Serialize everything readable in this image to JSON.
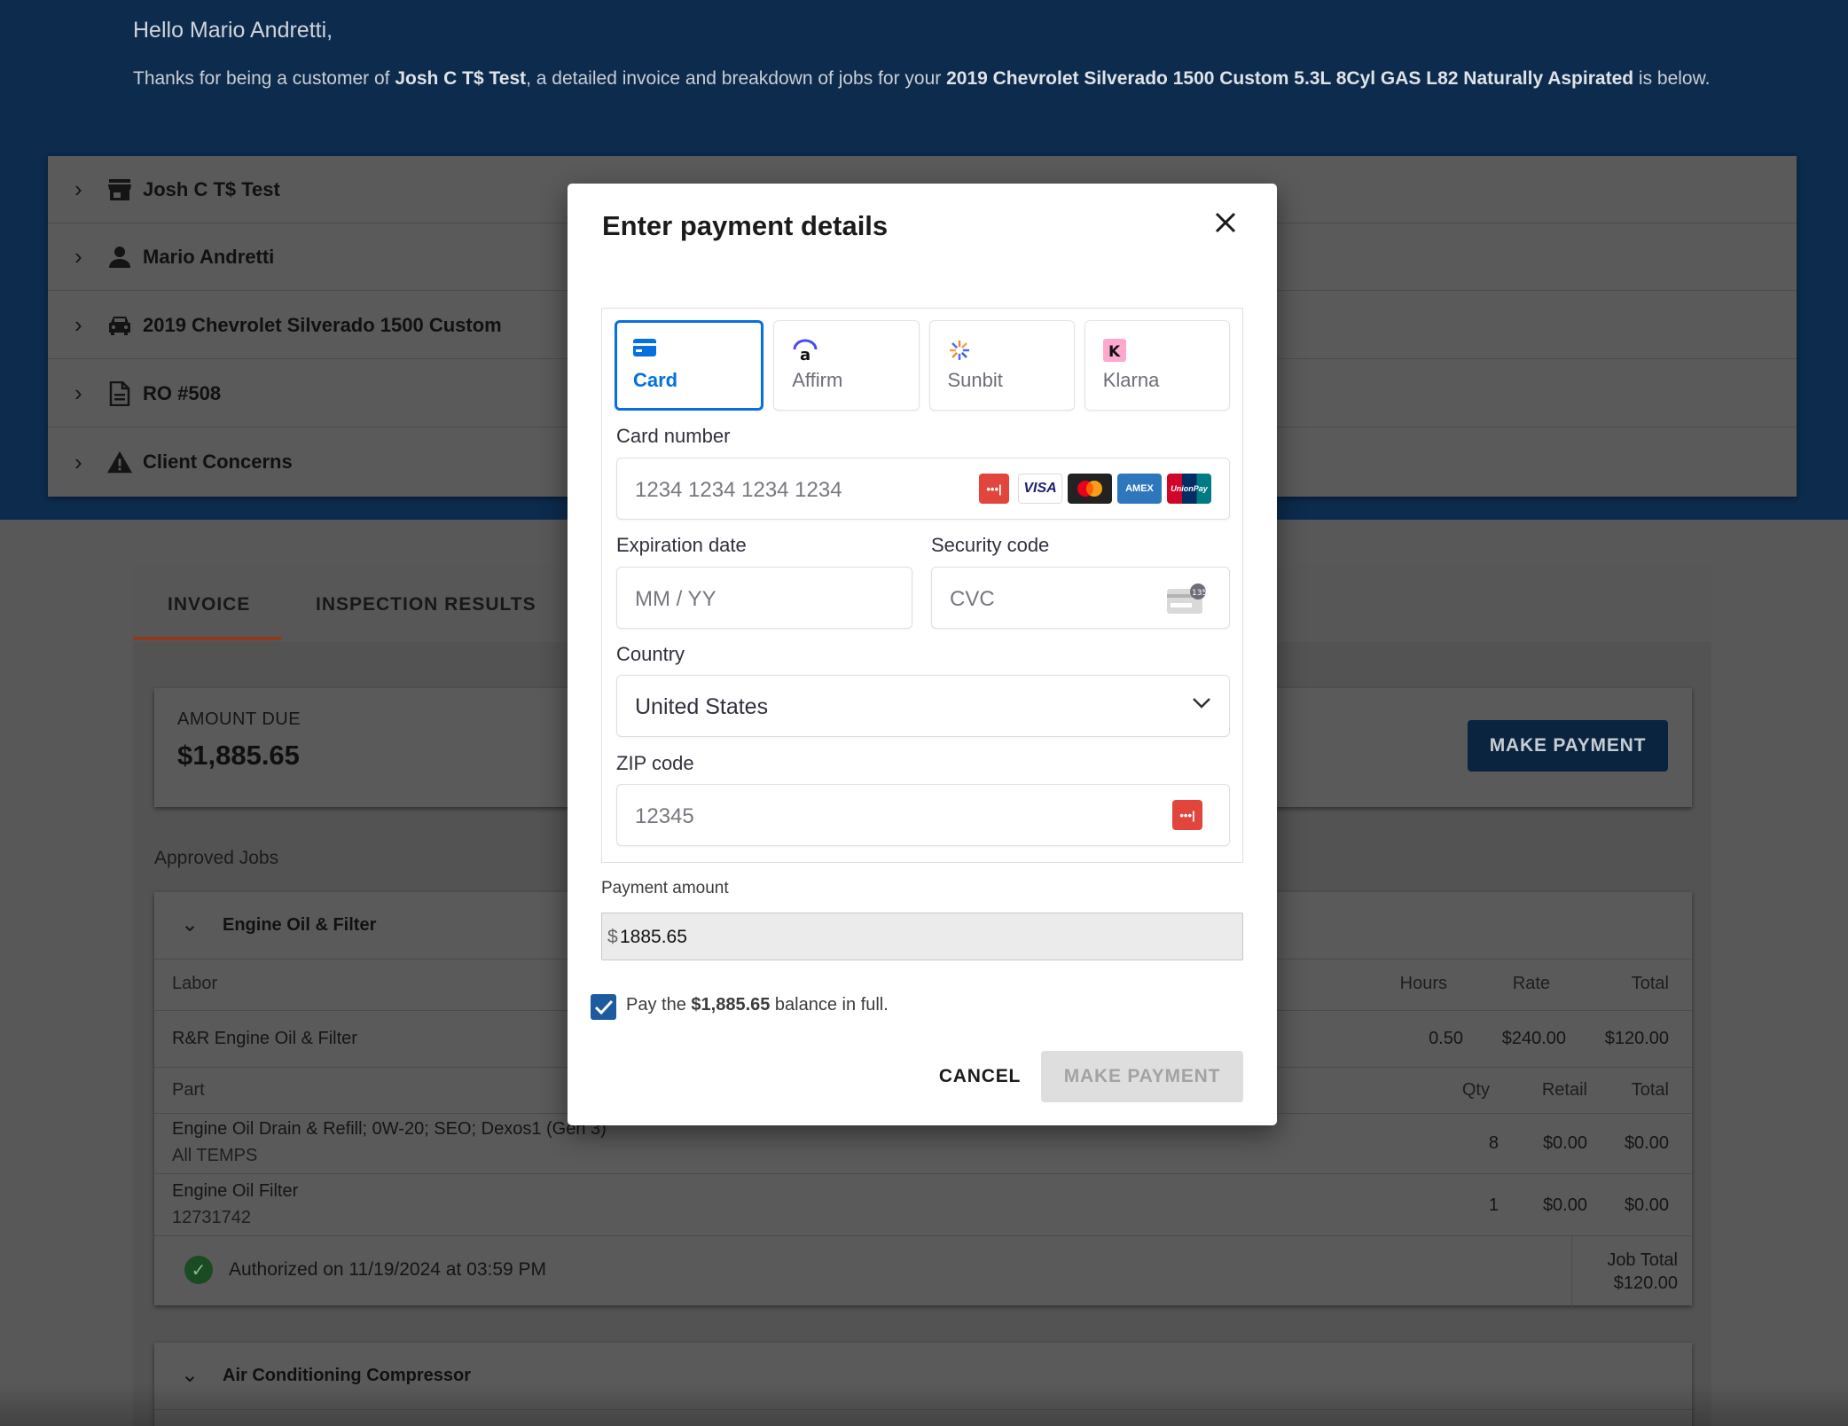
{
  "greeting": "Hello Mario Andretti,",
  "intro": {
    "prefix": "Thanks for being a customer of ",
    "shop": "Josh C T$ Test",
    "middle": ", a detailed invoice and breakdown of jobs for your ",
    "vehicle": "2019 Chevrolet Silverado 1500 Custom 5.3L 8Cyl GAS L82 Naturally Aspirated",
    "suffix": " is below."
  },
  "accordion": [
    {
      "icon": "store-icon",
      "label": "Josh C T$ Test"
    },
    {
      "icon": "person-icon",
      "label": "Mario Andretti"
    },
    {
      "icon": "car-icon",
      "label": "2019 Chevrolet Silverado 1500 Custom"
    },
    {
      "icon": "document-icon",
      "label": "RO #508"
    },
    {
      "icon": "warning-icon",
      "label": "Client Concerns"
    }
  ],
  "tabs": {
    "invoice": "INVOICE",
    "inspection": "INSPECTION RESULTS"
  },
  "amount_due": {
    "label": "AMOUNT DUE",
    "value": "$1,885.65",
    "button": "MAKE PAYMENT"
  },
  "approved_jobs_label": "Approved Jobs",
  "job1": {
    "title": "Engine Oil & Filter",
    "labor_headers": {
      "labor": "Labor",
      "hours": "Hours",
      "rate": "Rate",
      "total": "Total"
    },
    "labor_row": {
      "name": "R&R Engine Oil & Filter",
      "hours": "0.50",
      "rate": "$240.00",
      "total": "$120.00"
    },
    "part_headers": {
      "part": "Part",
      "qty": "Qty",
      "retail": "Retail",
      "total": "Total"
    },
    "parts": [
      {
        "name": "Engine Oil Drain & Refill; 0W-20; SEO; Dexos1 (Gen 3)",
        "sub": "All TEMPS",
        "qty": "8",
        "retail": "$0.00",
        "total": "$0.00"
      },
      {
        "name": "Engine Oil Filter",
        "sub": "12731742",
        "qty": "1",
        "retail": "$0.00",
        "total": "$0.00"
      }
    ],
    "authorized": "Authorized on 11/19/2024 at 03:59 PM",
    "job_total_label": "Job Total",
    "job_total_value": "$120.00"
  },
  "job2": {
    "title": "Air Conditioning Compressor"
  },
  "modal": {
    "title": "Enter payment details",
    "methods": [
      {
        "label": "Card",
        "icon": "card-icon",
        "active": true
      },
      {
        "label": "Affirm",
        "icon": "affirm-icon",
        "active": false
      },
      {
        "label": "Sunbit",
        "icon": "sunbit-icon",
        "active": false
      },
      {
        "label": "Klarna",
        "icon": "klarna-icon",
        "active": false
      }
    ],
    "card_number_label": "Card number",
    "card_number_placeholder": "1234 1234 1234 1234",
    "card_brands": [
      "VISA",
      "AMEX",
      "UnionPay"
    ],
    "expiration_label": "Expiration date",
    "expiration_placeholder": "MM / YY",
    "security_label": "Security code",
    "security_placeholder": "CVC",
    "cvc_hint": "135",
    "country_label": "Country",
    "country_value": "United States",
    "zip_label": "ZIP code",
    "zip_placeholder": "12345",
    "payment_amount_label": "Payment amount",
    "currency_symbol": "$",
    "payment_amount_value": "1885.65",
    "pay_in_full": {
      "prefix": "Pay the ",
      "amount": "$1,885.65",
      "suffix": " balance in full.",
      "checked": true
    },
    "cancel_label": "CANCEL",
    "submit_label": "MAKE PAYMENT"
  },
  "colors": {
    "brand_navy": "#0c2b4d",
    "stripe_blue": "#0570de",
    "check_blue": "#1d5aa0",
    "tab_accent": "#c8511b"
  }
}
